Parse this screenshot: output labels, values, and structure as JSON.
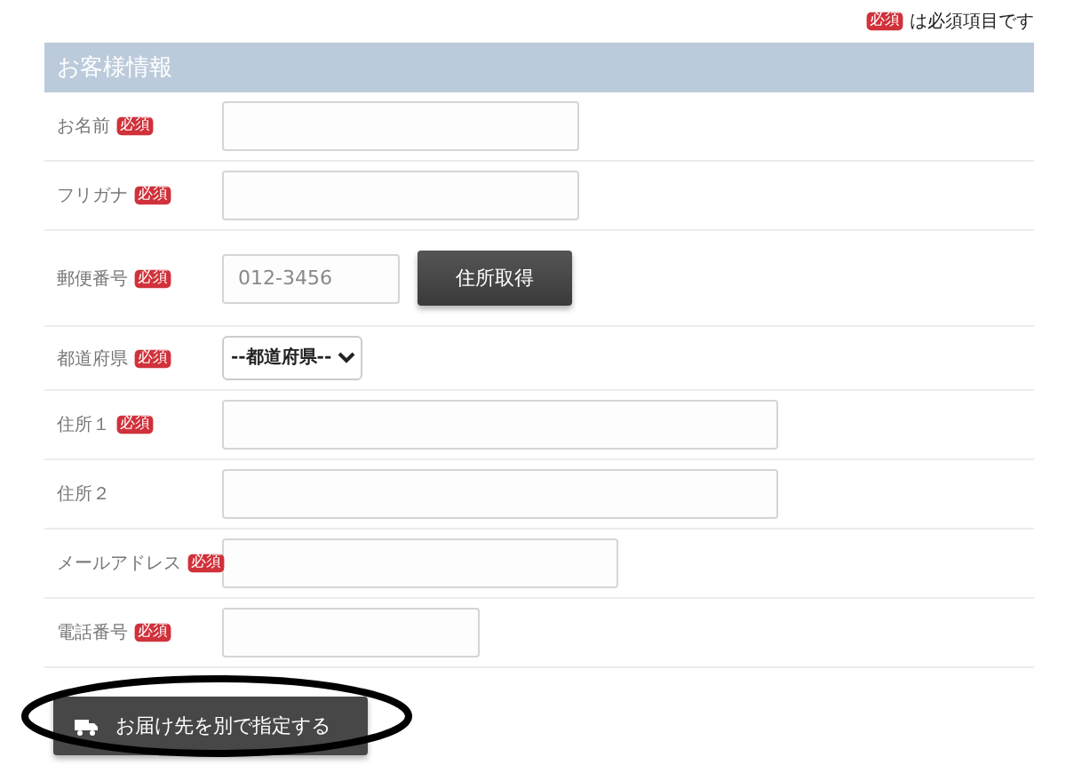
{
  "legend": {
    "badge": "必須",
    "text": "は必須項目です"
  },
  "section": {
    "title": "お客様情報"
  },
  "fields": [
    {
      "kind": "text",
      "label": "お名前",
      "badge": "必須"
    },
    {
      "kind": "text",
      "label": "フリガナ",
      "badge": "必須"
    },
    {
      "kind": "postal",
      "label": "郵便番号",
      "badge": "必須",
      "placeholder": "012-3456",
      "button": "住所取得"
    },
    {
      "kind": "select",
      "label": "都道府県",
      "badge": "必須",
      "value": "--都道府県--"
    },
    {
      "kind": "text",
      "label": "住所１",
      "badge": "必須"
    },
    {
      "kind": "text",
      "label": "住所２"
    },
    {
      "kind": "text",
      "label": "メールアドレス",
      "badge": "必須"
    },
    {
      "kind": "text",
      "label": "電話番号",
      "badge": "必須"
    }
  ],
  "delivery_button": {
    "label": "お届け先を別で指定する"
  }
}
